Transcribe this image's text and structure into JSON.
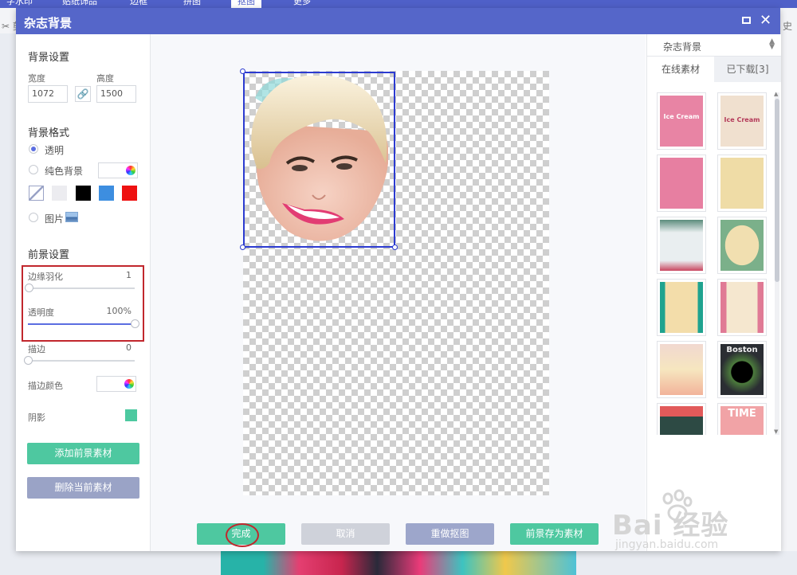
{
  "background_app": {
    "tabs": [
      "字水印",
      "贴纸饰品",
      "边框",
      "拼图",
      "抠图",
      "更多"
    ],
    "active_tab": "抠图",
    "toolbar_left": "✂ 剪",
    "toolbar_right": "史"
  },
  "dialog": {
    "title": "杂志背景",
    "left": {
      "bg_settings_title": "背景设置",
      "width_label": "宽度",
      "width_value": "1072",
      "height_label": "高度",
      "height_value": "1500",
      "bg_format_title": "背景格式",
      "opt_transparent": "透明",
      "opt_solid": "纯色背景",
      "opt_image": "图片",
      "selected_option": "透明",
      "swatches": [
        "#ffffff",
        "#ececf0",
        "#000000",
        "#3d8ee0",
        "#ee1111"
      ],
      "fg_settings_title": "前景设置",
      "feather_label": "边缘羽化",
      "feather_value": "1",
      "feather_level": 0.01,
      "opacity_label": "透明度",
      "opacity_value": "100%",
      "opacity_level": 1.0,
      "stroke_label": "描边",
      "stroke_value": "0",
      "stroke_level": 0,
      "stroke_color_label": "描边颜色",
      "shadow_label": "阴影",
      "shadow_color": "#4dc9a0",
      "add_fg_button": "添加前景素材",
      "delete_fg_button": "删除当前素材"
    },
    "bottom_buttons": {
      "done": "完成",
      "cancel": "取消",
      "redo_cutout": "重做抠图",
      "save_fg": "前景存为素材"
    },
    "right": {
      "category_select": "杂志背景",
      "tab_online": "在线素材",
      "tab_downloaded": "已下载[3]",
      "thumbnail_texts": [
        "Ice Cream",
        "Ice Cream",
        "",
        "",
        "",
        "",
        "",
        "",
        "",
        "Boston",
        "",
        "TIME"
      ]
    }
  },
  "watermark": {
    "brand": "Bai 经验",
    "url": "jingyan.baidu.com"
  },
  "colors": {
    "title_bar": "#5566c9",
    "accent": "#5b6ee1",
    "green_button": "#4ec8a0",
    "highlight_red": "#c1272d"
  }
}
